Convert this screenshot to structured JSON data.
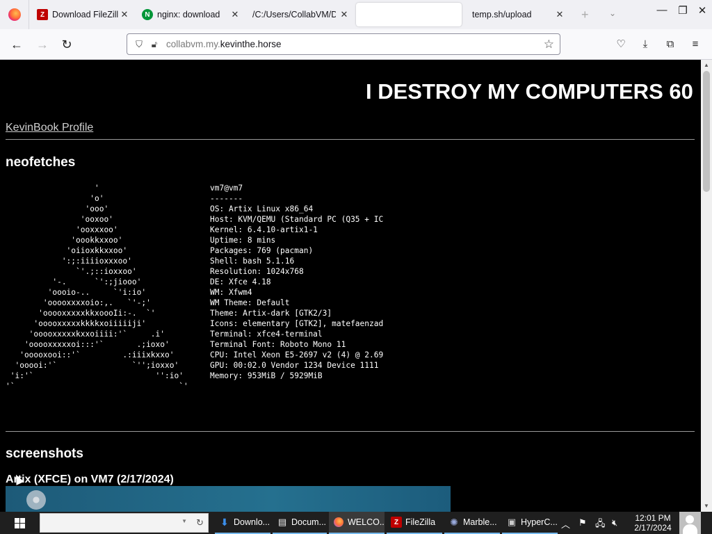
{
  "tabs": [
    {
      "title": "Download FileZill",
      "favicon": "filezilla-icon",
      "active": false
    },
    {
      "title": "nginx: download",
      "favicon": "nginx-icon",
      "active": false
    },
    {
      "title": "/C:/Users/CollabVM/D",
      "favicon": "none",
      "active": false
    },
    {
      "title": "",
      "favicon": "none",
      "active": true
    },
    {
      "title": "temp.sh/upload",
      "favicon": "none",
      "active": false
    }
  ],
  "tab_close_glyph": "✕",
  "url": {
    "prefix": "collabvm.my.",
    "domain": "kevinthe.horse"
  },
  "page": {
    "banner": "I DESTROY MY COMPUTERS 60",
    "profile_link": "KevinBook Profile",
    "section_neofetch": "neofetches",
    "neofetch_ascii": "                   '\n                  'o'\n                 'ooo'\n                'ooxoo'\n               'ooxxxoo'\n              'oookkxxoo'\n             'oiioxkkxxoo'\n            ':;:iiiioxxxoo'\n               `'.;::ioxxoo'\n          '-.      `':;jiooo'\n         'oooio-..     `'i:io'\n        'ooooxxxxoio:,.   `'-;'\n       'ooooxxxxxkkxoooIi:-.  `'\n      'ooooxxxxxkkkkxoiiiiiji'\n     'ooooxxxxxkxxoiiii:'`     .i'\n    'ooooxxxxxoi:::'`       .;ioxo'\n   'ooooxooi::'`         .:iiixkxxo'\n  'ooooi:'`                `'';ioxxo'\n 'i:'`                          '':io'\n'`                                   `'",
    "neofetch_info": "vm7@vm7\n-------\nOS: Artix Linux x86_64\nHost: KVM/QEMU (Standard PC (Q35 + IC\nKernel: 6.4.10-artix1-1\nUptime: 8 mins\nPackages: 769 (pacman)\nShell: bash 5.1.16\nResolution: 1024x768\nDE: Xfce 4.18\nWM: Xfwm4\nWM Theme: Default\nTheme: Artix-dark [GTK2/3]\nIcons: elementary [GTK2], matefaenzad\nTerminal: xfce4-terminal\nTerminal Font: Roboto Mono 11\nCPU: Intel Xeon E5-2697 v2 (4) @ 2.69\nGPU: 00:02.0 Vendor 1234 Device 1111\nMemory: 953MiB / 5929MiB",
    "section_screenshots": "screenshots",
    "screenshot_caption": "Artix (XFCE) on VM7 (2/17/2024)"
  },
  "taskbar": {
    "items": [
      {
        "label": "Downlo...",
        "icon": "download-arrow-icon",
        "open": true,
        "active": false
      },
      {
        "label": "Docum...",
        "icon": "document-icon",
        "open": true,
        "active": false
      },
      {
        "label": "WELCO...",
        "icon": "firefox-icon",
        "open": true,
        "active": true
      },
      {
        "label": "FileZilla",
        "icon": "filezilla-icon",
        "open": true,
        "active": false
      },
      {
        "label": "Marble...",
        "icon": "marble-icon",
        "open": true,
        "active": false
      },
      {
        "label": "HyperC...",
        "icon": "hyperc-icon",
        "open": true,
        "active": false
      }
    ],
    "clock_time": "12:01 PM",
    "clock_date": "2/17/2024"
  },
  "colors": {
    "page_bg": "#000000",
    "page_text": "#ffffff",
    "taskbar_bg": "#1f1f1f",
    "taskbar_underline": "#76b9ed"
  }
}
